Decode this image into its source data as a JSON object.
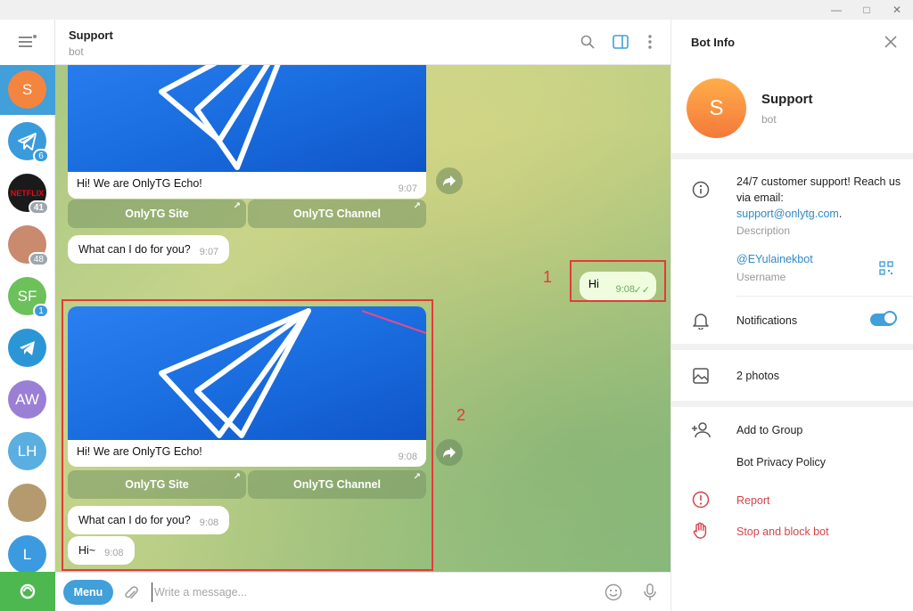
{
  "chat": {
    "title": "Support",
    "subtitle": "bot",
    "messages": {
      "echo1": {
        "text": "Hi! We are OnlyTG Echo!",
        "time": "9:07"
      },
      "kb1": {
        "site": "OnlyTG Site",
        "channel": "OnlyTG Channel"
      },
      "ask1": {
        "text": "What can I do for you?",
        "time": "9:07"
      },
      "out": {
        "text": "Hi",
        "time": "9:08"
      },
      "echo2": {
        "text": "Hi! We are OnlyTG Echo!",
        "time": "9:08"
      },
      "kb2": {
        "site": "OnlyTG Site",
        "channel": "OnlyTG Channel"
      },
      "ask2": {
        "text": "What can I do for you?",
        "time": "9:08"
      },
      "reply": {
        "text": "Hi~",
        "time": "9:08"
      }
    },
    "annotations": {
      "one": "1",
      "two": "2"
    }
  },
  "chat_list": [
    {
      "label": "S",
      "color": "#f4853f",
      "badge": ""
    },
    {
      "label": "",
      "color": "#3a9bdc",
      "badge": "6"
    },
    {
      "label": "NETFLIX",
      "color": "#1a1a1a",
      "badge": "41"
    },
    {
      "label": "",
      "color": "#c98a6e",
      "badge": "48"
    },
    {
      "label": "SF",
      "color": "#6cc15a",
      "badge": "1"
    },
    {
      "label": "",
      "color": "#2b96d6",
      "badge": ""
    },
    {
      "label": "AW",
      "color": "#9b7fd4",
      "badge": ""
    },
    {
      "label": "LH",
      "color": "#5aaee0",
      "badge": ""
    },
    {
      "label": "",
      "color": "#b59a70",
      "badge": ""
    },
    {
      "label": "L",
      "color": "#3c9be0",
      "badge": ""
    }
  ],
  "compose": {
    "menu_label": "Menu",
    "placeholder": "Write a message..."
  },
  "bot_info": {
    "title": "Bot Info",
    "avatar_letter": "S",
    "name": "Support",
    "subtitle": "bot",
    "description_text": "24/7 customer support! Reach us via email:",
    "email": "support@onlytg.com",
    "email_suffix": ".",
    "description_label": "Description",
    "username": "@EYulainekbot",
    "username_label": "Username",
    "notifications_label": "Notifications",
    "notifications_on": true,
    "photos_label": "2 photos",
    "add_to_group": "Add to Group",
    "privacy_policy": "Bot Privacy Policy",
    "report": "Report",
    "stop_block": "Stop and block bot"
  },
  "colors": {
    "accent": "#419fd9",
    "danger": "#d3444d",
    "annotation": "#e23b3b"
  }
}
